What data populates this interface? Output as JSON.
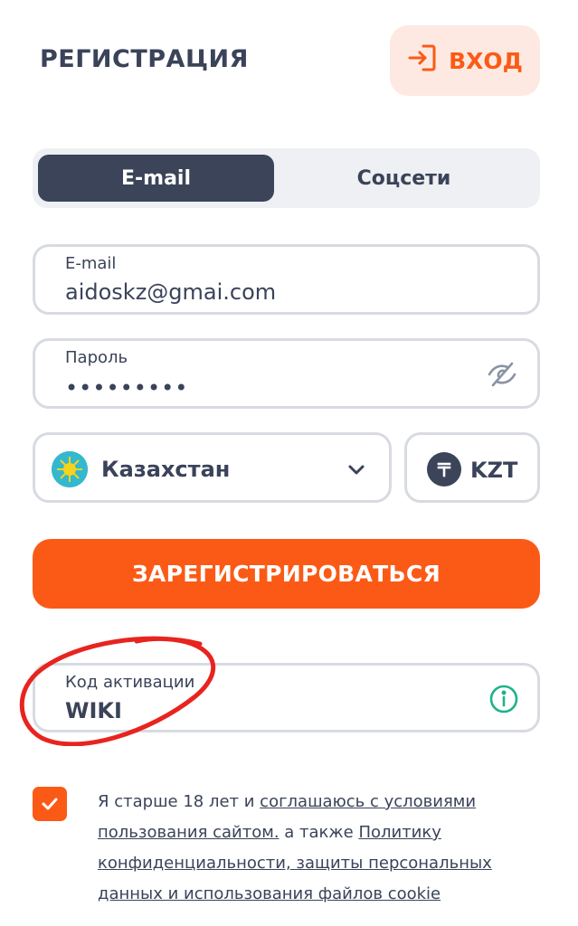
{
  "header": {
    "title": "РЕГИСТРАЦИЯ",
    "login_label": "ВХОД"
  },
  "tabs": [
    {
      "label": "E-mail",
      "active": true
    },
    {
      "label": "Соцсети",
      "active": false
    }
  ],
  "email_field": {
    "label": "E-mail",
    "value": "aidoskz@gmai.com"
  },
  "password_field": {
    "label": "Пароль",
    "value": "•••••••••"
  },
  "country_select": {
    "value": "Казахстан"
  },
  "currency_select": {
    "value": "KZT"
  },
  "register_button": {
    "label": "ЗАРЕГИСТРИРОВАТЬСЯ"
  },
  "activation_field": {
    "label": "Код активации",
    "value": "WIKI"
  },
  "consent": {
    "checked": true,
    "text_1": "Я старше 18 лет и ",
    "link_1": "соглашаюсь с условиями пользования сайтом.",
    "text_2": " а также ",
    "link_2": "Политику конфиденциальности, защиты персональных данных и использования файлов cookie"
  },
  "colors": {
    "accent": "#fb5a16",
    "dark": "#3b4458",
    "info": "#1db38a",
    "annotation": "#e8241f"
  }
}
